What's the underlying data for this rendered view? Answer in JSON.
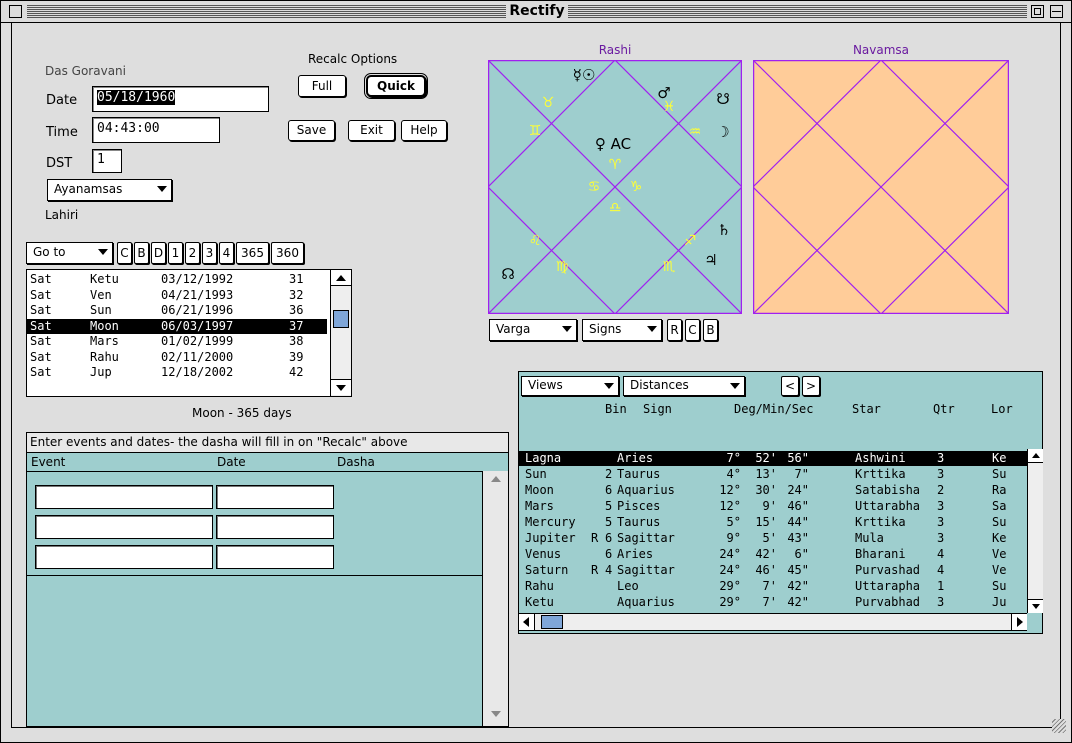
{
  "window": {
    "title": "Rectify"
  },
  "person": {
    "name": "Das Goravani",
    "date_label": "Date",
    "date_value": "05/18/1960",
    "time_label": "Time",
    "time_value": "04:43:00",
    "dst_label": "DST",
    "dst_value": "1",
    "ayanamsa_popup": "Ayanamsas",
    "ayanamsa_value": "Lahiri"
  },
  "recalc": {
    "label": "Recalc Options",
    "full": "Full",
    "quick": "Quick",
    "save": "Save",
    "exit": "Exit",
    "help": "Help"
  },
  "nav": {
    "goto": "Go to",
    "buttons": [
      "C",
      "B",
      "D",
      "1",
      "2",
      "3",
      "4",
      "365",
      "360"
    ]
  },
  "dasha_list": [
    {
      "maha": "Sat",
      "bhukti": "Ketu",
      "date": "03/12/1992",
      "age": "31"
    },
    {
      "maha": "Sat",
      "bhukti": "Ven",
      "date": "04/21/1993",
      "age": "32"
    },
    {
      "maha": "Sat",
      "bhukti": "Sun",
      "date": "06/21/1996",
      "age": "36"
    },
    {
      "maha": "Sat",
      "bhukti": "Moon",
      "date": "06/03/1997",
      "age": "37"
    },
    {
      "maha": "Sat",
      "bhukti": "Mars",
      "date": "01/02/1999",
      "age": "38"
    },
    {
      "maha": "Sat",
      "bhukti": "Rahu",
      "date": "02/11/2000",
      "age": "39"
    },
    {
      "maha": "Sat",
      "bhukti": "Jup",
      "date": "12/18/2002",
      "age": "42"
    }
  ],
  "dasha_selected_index": 3,
  "period_info": "Moon - 365 days",
  "events": {
    "instructions": "Enter events and dates- the dasha will fill in on \"Recalc\" above",
    "col_event": "Event",
    "col_date": "Date",
    "col_dasha": "Dasha",
    "rows": [
      {
        "event": "",
        "date": "",
        "dasha": ""
      },
      {
        "event": "",
        "date": "",
        "dasha": ""
      },
      {
        "event": "",
        "date": "",
        "dasha": ""
      }
    ]
  },
  "rashi": {
    "title": "Rashi",
    "bg_color": "#9ecece",
    "line_color": "#a020f0",
    "sign_color": "#ffff33",
    "signs": [
      "♉",
      "♓",
      "♒",
      "♊",
      "♈",
      "♋",
      "♑",
      "♎",
      "♌",
      "♐",
      "♍",
      "♏"
    ],
    "planets": [
      "☿☉",
      "♂",
      "☋",
      "♀ AC",
      "☽",
      "♄",
      "♃",
      "☊"
    ]
  },
  "navamsa": {
    "title": "Navamsa",
    "bg_color": "#ffcc99",
    "line_color": "#a020f0"
  },
  "chart_controls": {
    "varga": "Varga",
    "signs": "Signs",
    "r": "R",
    "c": "C",
    "b": "B"
  },
  "planet_table": {
    "views": "Views",
    "distances": "Distances",
    "prev": "<",
    "next": ">",
    "headers": [
      "Bin",
      "Sign",
      "Deg/Min/Sec",
      "Star",
      "Qtr",
      "Lor"
    ],
    "rows": [
      {
        "planet": "Lagna",
        "retro": "",
        "bin": "",
        "sign": "Aries",
        "deg": "7°",
        "min": "52'",
        "sec": "56\"",
        "star": "Ashwini",
        "qtr": "3",
        "lord": "Ke"
      },
      {
        "planet": "Sun",
        "retro": "",
        "bin": "2",
        "sign": "Taurus",
        "deg": "4°",
        "min": "13'",
        "sec": "7\"",
        "star": "Krttika",
        "qtr": "3",
        "lord": "Su"
      },
      {
        "planet": "Moon",
        "retro": "",
        "bin": "6",
        "sign": "Aquarius",
        "deg": "12°",
        "min": "30'",
        "sec": "24\"",
        "star": "Satabisha",
        "qtr": "2",
        "lord": "Ra"
      },
      {
        "planet": "Mars",
        "retro": "",
        "bin": "5",
        "sign": "Pisces",
        "deg": "12°",
        "min": "9'",
        "sec": "46\"",
        "star": "Uttarabha",
        "qtr": "3",
        "lord": "Sa"
      },
      {
        "planet": "Mercury",
        "retro": "",
        "bin": "5",
        "sign": "Taurus",
        "deg": "5°",
        "min": "15'",
        "sec": "44\"",
        "star": "Krttika",
        "qtr": "3",
        "lord": "Su"
      },
      {
        "planet": "Jupiter",
        "retro": "R",
        "bin": "6",
        "sign": "Sagittar",
        "deg": "9°",
        "min": "5'",
        "sec": "43\"",
        "star": "Mula",
        "qtr": "3",
        "lord": "Ke"
      },
      {
        "planet": "Venus",
        "retro": "",
        "bin": "6",
        "sign": "Aries",
        "deg": "24°",
        "min": "42'",
        "sec": "6\"",
        "star": "Bharani",
        "qtr": "4",
        "lord": "Ve"
      },
      {
        "planet": "Saturn",
        "retro": "R",
        "bin": "4",
        "sign": "Sagittar",
        "deg": "24°",
        "min": "46'",
        "sec": "45\"",
        "star": "Purvashad",
        "qtr": "4",
        "lord": "Ve"
      },
      {
        "planet": "Rahu",
        "retro": "",
        "bin": "",
        "sign": "Leo",
        "deg": "29°",
        "min": "7'",
        "sec": "42\"",
        "star": "Uttarapha",
        "qtr": "1",
        "lord": "Su"
      },
      {
        "planet": "Ketu",
        "retro": "",
        "bin": "",
        "sign": "Aquarius",
        "deg": "29°",
        "min": "7'",
        "sec": "42\"",
        "star": "Purvabhad",
        "qtr": "3",
        "lord": "Ju"
      }
    ],
    "selected_index": 0
  },
  "icons": [
    "close-box-icon",
    "zoom-box-icon",
    "collapse-box-icon",
    "scroll-up-arrow-icon",
    "scroll-down-arrow-icon",
    "grow-box-icon"
  ]
}
